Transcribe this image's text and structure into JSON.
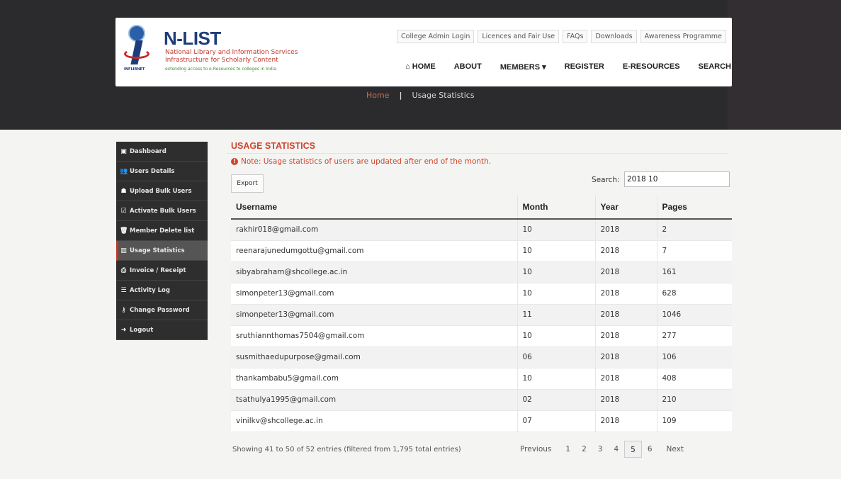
{
  "brand": {
    "title": "N-LIST",
    "sub1": "National Library and Information Services",
    "sub2": "Infrastructure for Scholarly Content",
    "tagline": "extending access to e-Resources to colleges in India",
    "logo_caption": "INFLIBNET"
  },
  "topnav": [
    "College Admin Login",
    "Licences and Fair Use",
    "FAQs",
    "Downloads",
    "Awareness Programme"
  ],
  "mainnav": {
    "home": "HOME",
    "about": "ABOUT",
    "members": "MEMBERS",
    "register": "REGISTER",
    "eresources": "E-RESOURCES",
    "search": "SEARCH"
  },
  "breadcrumb": {
    "home": "Home",
    "sep": "|",
    "current": "Usage Statistics"
  },
  "sidebar": {
    "items": [
      {
        "label": "Dashboard",
        "icon": "dashboard-icon",
        "glyph": "▣"
      },
      {
        "label": "Users Details",
        "icon": "users-icon",
        "glyph": "👥"
      },
      {
        "label": "Upload Bulk Users",
        "icon": "upload-users-icon",
        "glyph": "☗"
      },
      {
        "label": "Activate Bulk Users",
        "icon": "check-square-icon",
        "glyph": "☑"
      },
      {
        "label": "Member Delete list",
        "icon": "trash-icon",
        "glyph": "🗑"
      },
      {
        "label": "Usage Statistics",
        "icon": "bar-chart-icon",
        "glyph": "▥"
      },
      {
        "label": "Invoice / Receipt",
        "icon": "print-icon",
        "glyph": "⎙"
      },
      {
        "label": "Activity Log",
        "icon": "list-icon",
        "glyph": "☰"
      },
      {
        "label": "Change Password",
        "icon": "key-icon",
        "glyph": "⚷"
      },
      {
        "label": "Logout",
        "icon": "logout-icon",
        "glyph": "➜"
      }
    ],
    "active_index": 5
  },
  "page": {
    "title": "USAGE STATISTICS",
    "note": "Note: Usage statistics of users are updated after end of the month.",
    "export_label": "Export",
    "search_label": "Search:",
    "search_value": "2018 10"
  },
  "table": {
    "headers": [
      "Username",
      "Month",
      "Year",
      "Pages"
    ],
    "rows": [
      [
        "rakhir018@gmail.com",
        "10",
        "2018",
        "2"
      ],
      [
        "reenarajunedumgottu@gmail.com",
        "10",
        "2018",
        "7"
      ],
      [
        "sibyabraham@shcollege.ac.in",
        "10",
        "2018",
        "161"
      ],
      [
        "simonpeter13@gmail.com",
        "10",
        "2018",
        "628"
      ],
      [
        "simonpeter13@gmail.com",
        "11",
        "2018",
        "1046"
      ],
      [
        "sruthiannthomas7504@gmail.com",
        "10",
        "2018",
        "277"
      ],
      [
        "susmithaedupurpose@gmail.com",
        "06",
        "2018",
        "106"
      ],
      [
        "thankambabu5@gmail.com",
        "10",
        "2018",
        "408"
      ],
      [
        "tsathulya1995@gmail.com",
        "02",
        "2018",
        "210"
      ],
      [
        "vinilkv@shcollege.ac.in",
        "07",
        "2018",
        "109"
      ]
    ]
  },
  "footer": {
    "info": "Showing 41 to 50 of 52 entries (filtered from 1,795 total entries)",
    "previous": "Previous",
    "pages": [
      "1",
      "2",
      "3",
      "4",
      "5",
      "6"
    ],
    "current_page": "5",
    "next": "Next"
  }
}
